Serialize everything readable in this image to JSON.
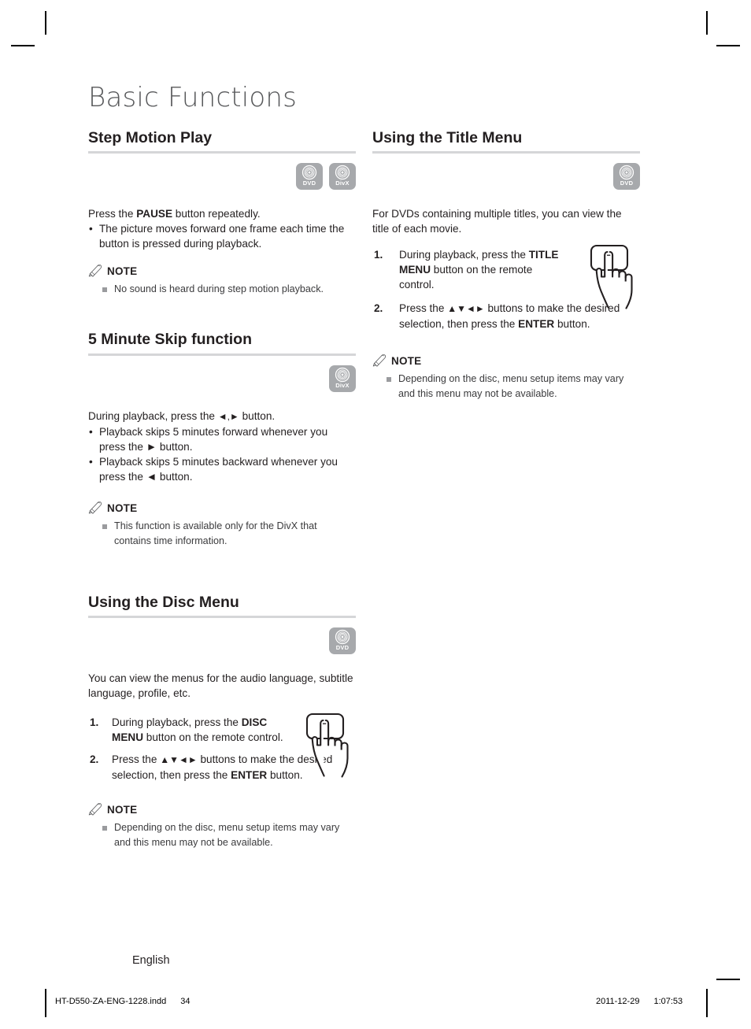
{
  "page": {
    "title": "Basic Functions",
    "language_label": "English"
  },
  "footer": {
    "file_name": "HT-D550-ZA-ENG-1228.indd",
    "page_number": "34",
    "date": "2011-12-29",
    "time": "1:07:53"
  },
  "badges": {
    "dvd_label": "DVD",
    "divx_label": "DivX",
    "color": "#a7a9ac"
  },
  "note_label": "NOTE",
  "left_column": {
    "sections": [
      {
        "heading": "Step Motion Play",
        "badges": [
          "DVD",
          "DivX"
        ],
        "lead": "Press the PAUSE button repeatedly.",
        "lead_parts": {
          "pre": "Press the ",
          "bold": "PAUSE",
          "post": " button repeatedly."
        },
        "bullets": [
          "The picture moves forward one frame each time the button is pressed during playback."
        ],
        "notes": [
          "No sound is heard during step motion playback."
        ]
      },
      {
        "heading": "5 Minute Skip function",
        "badges": [
          "DivX"
        ],
        "lead_parts": {
          "pre": "During playback, press the ",
          "arrows": "◄,►",
          "post": " button."
        },
        "bullets": [
          "Playback skips 5 minutes forward whenever you press the ► button.",
          "Playback skips 5 minutes backward whenever you press the ◄ button."
        ],
        "notes": [
          "This function is available only for the DivX that contains time information."
        ]
      },
      {
        "heading": "Using the Disc Menu",
        "badges": [
          "DVD"
        ],
        "lead": "You can view the menus for the audio language, subtitle language, profile, etc.",
        "steps": [
          {
            "num": "1.",
            "pre": "During playback, press the ",
            "bold": "DISC MENU",
            "post": " button on the remote control."
          },
          {
            "num": "2.",
            "pre": "Press the ",
            "arrows": "▲▼◄►",
            "mid": " buttons to make the desired selection, then press the ",
            "bold": "ENTER",
            "post": " button."
          }
        ],
        "notes": [
          "Depending on the disc, menu setup items may vary and this menu may not be available."
        ]
      }
    ]
  },
  "right_column": {
    "sections": [
      {
        "heading": "Using the Title Menu",
        "badges": [
          "DVD"
        ],
        "lead": "For DVDs containing multiple titles, you can view the title of each movie.",
        "steps": [
          {
            "num": "1.",
            "pre": "During playback, press the ",
            "bold": "TITLE MENU",
            "post": " button on the remote control."
          },
          {
            "num": "2.",
            "pre": "Press the ",
            "arrows": "▲▼◄►",
            "mid": " buttons to make the desired selection, then press the ",
            "bold": "ENTER",
            "post": " button."
          }
        ],
        "notes": [
          "Depending on the disc, menu setup items may vary and this menu may not be available."
        ]
      }
    ]
  }
}
